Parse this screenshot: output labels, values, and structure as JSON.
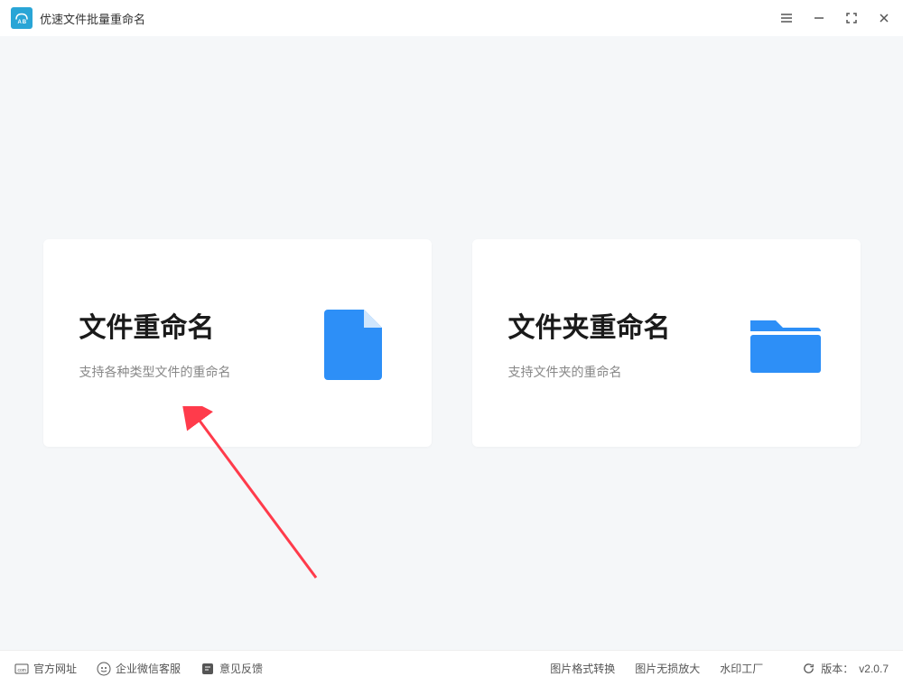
{
  "titlebar": {
    "app_title": "优速文件批量重命名"
  },
  "cards": {
    "file_rename": {
      "title": "文件重命名",
      "subtitle": "支持各种类型文件的重命名"
    },
    "folder_rename": {
      "title": "文件夹重命名",
      "subtitle": "支持文件夹的重命名"
    }
  },
  "footer": {
    "official_site": "官方网址",
    "wechat_support": "企业微信客服",
    "feedback": "意见反馈",
    "image_convert": "图片格式转换",
    "image_enlarge": "图片无损放大",
    "watermark": "水印工厂",
    "version_label": "版本：",
    "version_value": "v2.0.7"
  },
  "colors": {
    "accent": "#2d8ff7",
    "card_bg": "#ffffff",
    "main_bg": "#f5f7f9"
  }
}
